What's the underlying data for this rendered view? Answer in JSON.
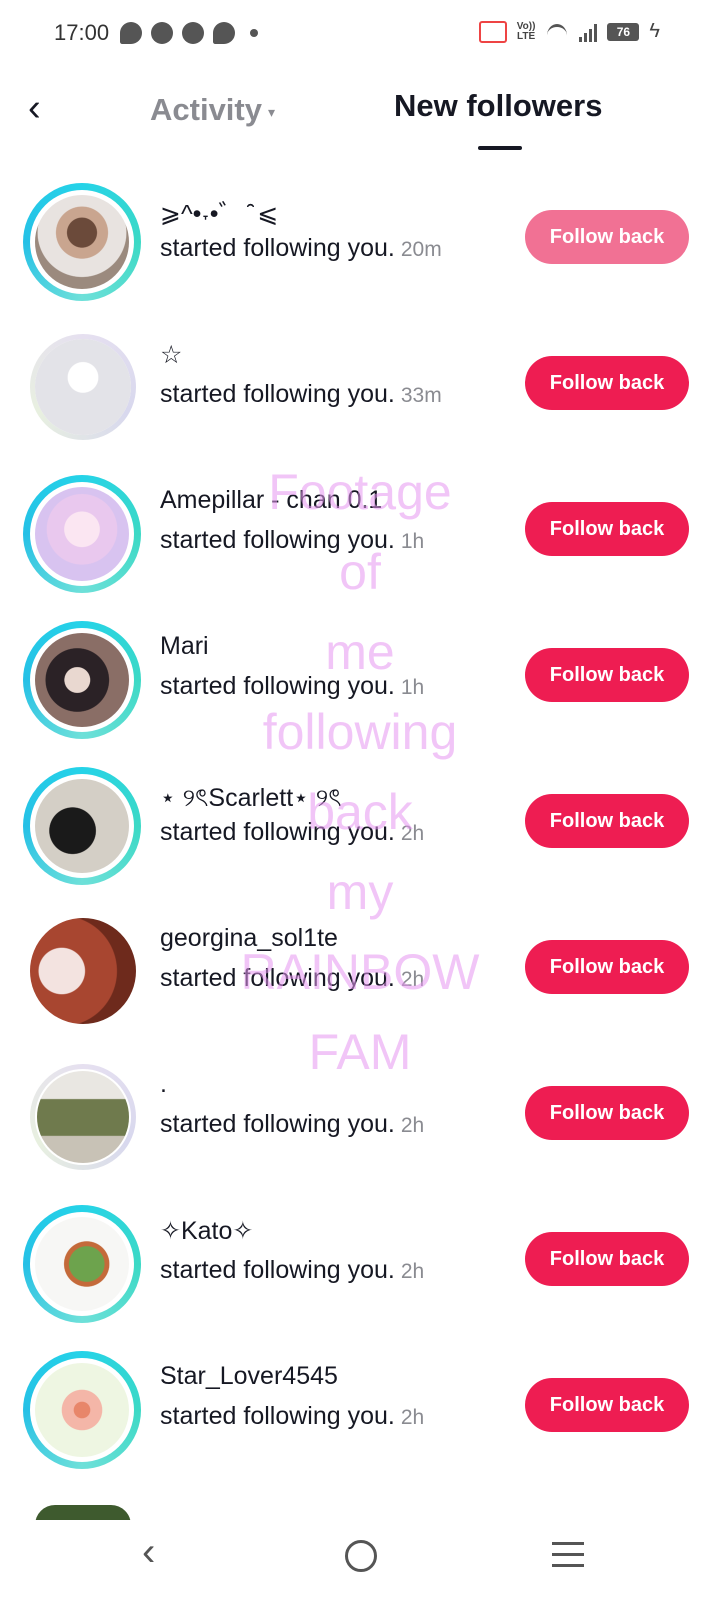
{
  "status_bar": {
    "time": "17:00",
    "left_icons": [
      "messenger-icon",
      "discord-icon",
      "facebook-icon",
      "chat-bubble-icon",
      "dot-icon"
    ],
    "volte_top": "Vo))",
    "volte_bottom": "LTE",
    "battery": "76"
  },
  "header": {
    "back_label": "‹",
    "tab_activity": "Activity",
    "tab_activity_caret": "▾",
    "tab_new_followers": "New followers",
    "active_tab": "New followers"
  },
  "rows": [
    {
      "name": "⩾^•˕•゛ ̑̑ ⩽",
      "action": "started following you.",
      "time": "20m",
      "button": "Follow back",
      "button_state": "pressed",
      "ring": "gradient"
    },
    {
      "name": "☆",
      "action": "started following you.",
      "time": "33m",
      "button": "Follow back",
      "button_state": "normal",
      "ring": "grey"
    },
    {
      "name": "Amepillar - chan 0.1",
      "action": "started following you.",
      "time": "1h",
      "button": "Follow back",
      "button_state": "normal",
      "ring": "gradient"
    },
    {
      "name": "Mari",
      "action": "started following you.",
      "time": "1h",
      "button": "Follow back",
      "button_state": "normal",
      "ring": "gradient"
    },
    {
      "name": "⋆ ୨ৎScarlett⋆ ୨ৎ",
      "action": "started following you.",
      "time": "2h",
      "button": "Follow back",
      "button_state": "normal",
      "ring": "gradient"
    },
    {
      "name": "georgina_sol1te",
      "action": "started following you.",
      "time": "2h",
      "button": "Follow back",
      "button_state": "normal",
      "ring": "none"
    },
    {
      "name": ".",
      "action": "started following you.",
      "time": "2h",
      "button": "Follow back",
      "button_state": "normal",
      "ring": "grey"
    },
    {
      "name": "✧Kato✧",
      "action": "started following you.",
      "time": "2h",
      "button": "Follow back",
      "button_state": "normal",
      "ring": "gradient"
    },
    {
      "name": "Star_Lover4545",
      "action": "started following you.",
      "time": "2h",
      "button": "Follow back",
      "button_state": "normal",
      "ring": "gradient"
    }
  ],
  "overlay_text": [
    "Footage",
    "of",
    "me",
    "following",
    "back",
    "my",
    "RAINBOW",
    "FAM"
  ],
  "navbar": {
    "back": "‹"
  },
  "colors": {
    "accent": "#ee1d52",
    "accent_pressed": "#f17194",
    "ring": "#25d3e8",
    "overlay": "#e696f0"
  }
}
